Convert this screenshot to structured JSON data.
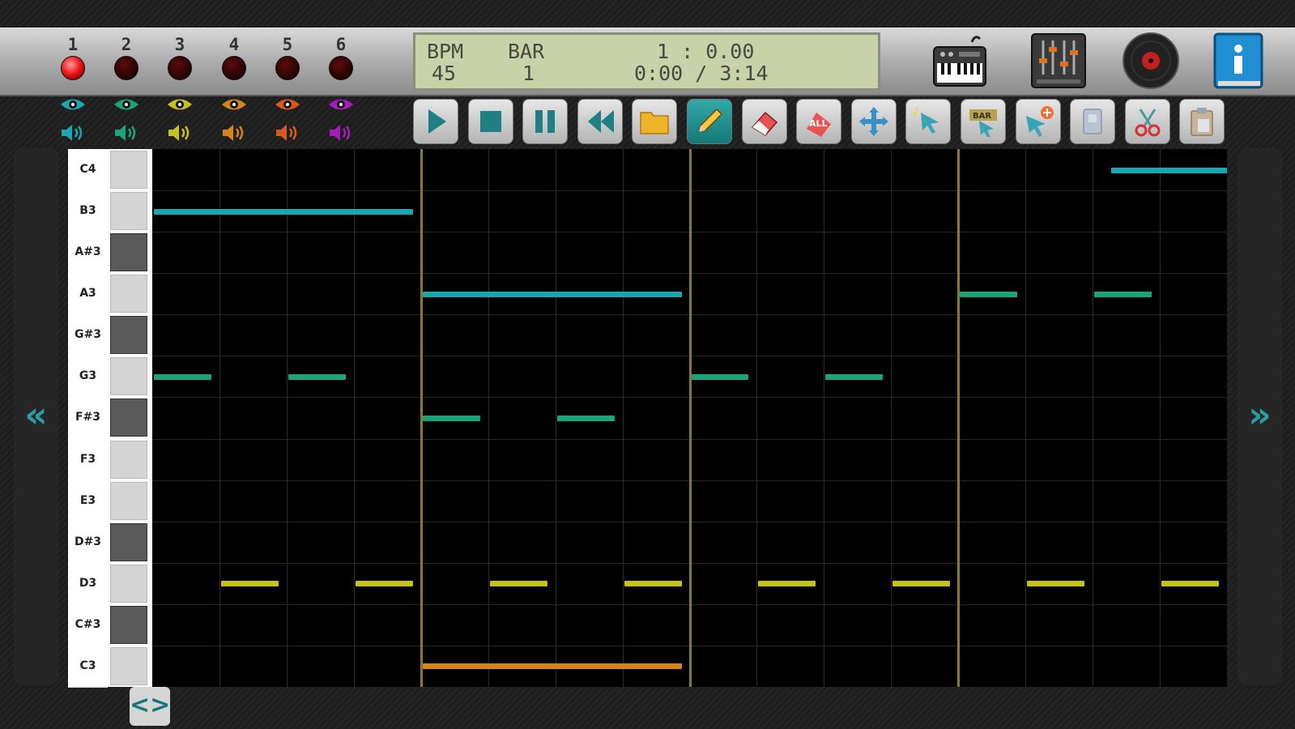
{
  "tracks": [
    {
      "number": "1",
      "active": true,
      "color": "#1aa7b2"
    },
    {
      "number": "2",
      "active": false,
      "color": "#19a57a"
    },
    {
      "number": "3",
      "active": false,
      "color": "#c6c21b"
    },
    {
      "number": "4",
      "active": false,
      "color": "#d4861b"
    },
    {
      "number": "5",
      "active": false,
      "color": "#d85a1f"
    },
    {
      "number": "6",
      "active": false,
      "color": "#a41dba"
    }
  ],
  "lcd": {
    "bpm_label": "BPM",
    "bpm_value": "45",
    "bar_label": "BAR",
    "bar_value": "1",
    "position": "1 : 0.00",
    "time": "0:00 / 3:14"
  },
  "top_icons": [
    "keyboard-icon",
    "mixer-icon",
    "vinyl-record-icon",
    "info-book-icon"
  ],
  "toolbar": [
    "play-icon",
    "stop-icon",
    "pause-icon",
    "rewind-icon",
    "folder-icon",
    "pencil-icon",
    "eraser-icon",
    "select-all-icon",
    "move-icon",
    "select-icon",
    "bar-select-icon",
    "add-pointer-icon",
    "copy-icon",
    "cut-icon",
    "paste-icon"
  ],
  "active_tool": "pencil-icon",
  "piano_keys": [
    {
      "label": "C4",
      "black": false
    },
    {
      "label": "B3",
      "black": false
    },
    {
      "label": "A#3",
      "black": true
    },
    {
      "label": "A3",
      "black": false
    },
    {
      "label": "G#3",
      "black": true
    },
    {
      "label": "G3",
      "black": false
    },
    {
      "label": "F#3",
      "black": true
    },
    {
      "label": "F3",
      "black": false
    },
    {
      "label": "E3",
      "black": false
    },
    {
      "label": "D#3",
      "black": true
    },
    {
      "label": "D3",
      "black": false
    },
    {
      "label": "C#3",
      "black": true
    },
    {
      "label": "C3",
      "black": false
    }
  ],
  "notes": [
    {
      "pitch": "C4",
      "start": 14.25,
      "length": 2
    },
    {
      "pitch": "B3",
      "start": 0,
      "length": 4
    },
    {
      "pitch": "A3",
      "start": 4,
      "length": 4,
      "color": "#1aa7b2"
    },
    {
      "pitch": "A3",
      "start": 12,
      "length": 1,
      "color": "#19a57a"
    },
    {
      "pitch": "A3",
      "start": 14,
      "length": 1,
      "color": "#19a57a"
    },
    {
      "pitch": "G3",
      "start": 0,
      "length": 1
    },
    {
      "pitch": "G3",
      "start": 2,
      "length": 1
    },
    {
      "pitch": "G3",
      "start": 8,
      "length": 1
    },
    {
      "pitch": "G3",
      "start": 10,
      "length": 1
    },
    {
      "pitch": "F#3",
      "start": 4,
      "length": 1
    },
    {
      "pitch": "F#3",
      "start": 6,
      "length": 1
    },
    {
      "pitch": "D3",
      "start": 1,
      "length": 1
    },
    {
      "pitch": "D3",
      "start": 3,
      "length": 1
    },
    {
      "pitch": "D3",
      "start": 5,
      "length": 1
    },
    {
      "pitch": "D3",
      "start": 7,
      "length": 1
    },
    {
      "pitch": "D3",
      "start": 9,
      "length": 1
    },
    {
      "pitch": "D3",
      "start": 11,
      "length": 1
    },
    {
      "pitch": "D3",
      "start": 13,
      "length": 1
    },
    {
      "pitch": "D3",
      "start": 15,
      "length": 1
    },
    {
      "pitch": "C3",
      "start": 4,
      "length": 4
    }
  ],
  "note_colors": {
    "C4": "#1aa7b2",
    "B3": "#1aa7b2",
    "G3": "#19a57a",
    "F#3": "#19a57a",
    "D3": "#c6c21b",
    "C3": "#d4861b"
  },
  "grid": {
    "steps": 16,
    "steps_per_bar": 4
  },
  "nav": {
    "left": "«",
    "right": "»",
    "scroll_toggle": "<>"
  }
}
